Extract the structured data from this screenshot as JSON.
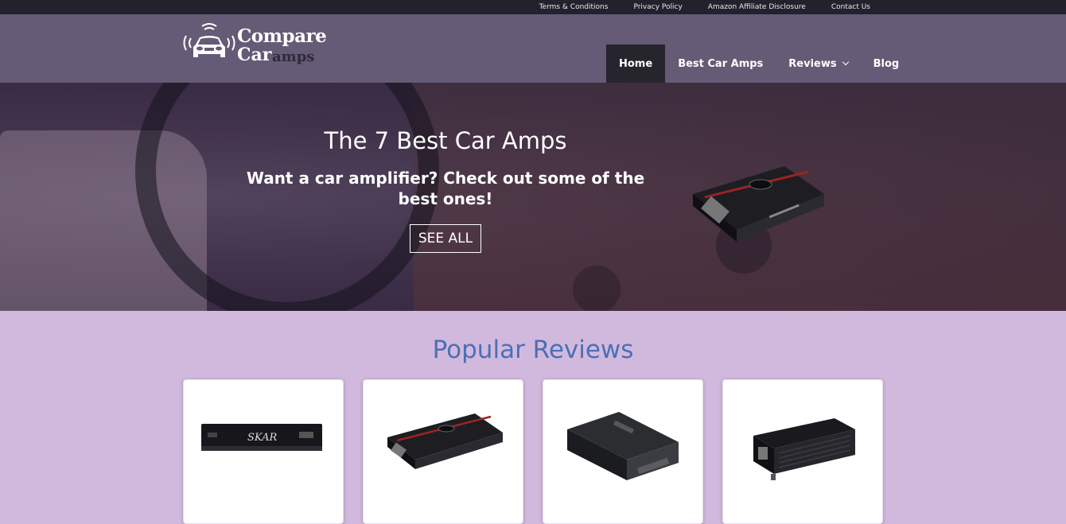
{
  "topbar": {
    "links": [
      "Terms & Conditions",
      "Privacy Policy",
      "Amazon Affiliate Disclosure",
      "Contact Us"
    ]
  },
  "header": {
    "logo": {
      "word1": "Compare",
      "word2": "Car",
      "word3": "amps"
    },
    "nav": [
      {
        "label": "Home",
        "active": true
      },
      {
        "label": "Best Car Amps",
        "active": false
      },
      {
        "label": "Reviews",
        "active": false,
        "has_dropdown": true
      },
      {
        "label": "Blog",
        "active": false
      }
    ]
  },
  "hero": {
    "title": "The 7 Best Car Amps",
    "subtitle": "Want a car amplifier? Check out some of the best ones!",
    "button_label": "SEE ALL"
  },
  "popular": {
    "title": "Popular Reviews",
    "cards": [
      {
        "image": "black-car-amplifier-skar"
      },
      {
        "image": "black-red-stripe-car-amplifier"
      },
      {
        "image": "dark-gray-car-amplifier"
      },
      {
        "image": "black-ribbed-car-amplifier"
      }
    ]
  },
  "colors": {
    "topbar": "#22222c",
    "header": "#655b76",
    "page_background": "#d1b9de",
    "section_title": "#4c6fb5",
    "nav_active": "#26242d"
  }
}
